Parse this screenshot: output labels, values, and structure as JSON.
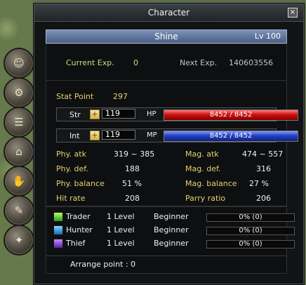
{
  "window": {
    "title": "Character",
    "close_icon": "×"
  },
  "character": {
    "name": "Shine",
    "level": "Lv 100"
  },
  "experience": {
    "current_label": "Current Exp.",
    "current_value": "0",
    "next_label": "Next Exp.",
    "next_value": "140603556"
  },
  "stat_point": {
    "label": "Stat Point",
    "value": "297"
  },
  "stats": {
    "str": {
      "label": "Str",
      "value": "119",
      "bar_label": "HP",
      "bar_text": "8452 / 8452",
      "fill_percent": 100
    },
    "int": {
      "label": "Int",
      "value": "119",
      "bar_label": "MP",
      "bar_text": "8452 / 8452",
      "fill_percent": 100
    }
  },
  "attributes": {
    "phy_atk_label": "Phy. atk",
    "phy_atk_value": "319 ~ 385",
    "phy_def_label": "Phy. def.",
    "phy_def_value": "188",
    "phy_balance_label": "Phy. balance",
    "phy_balance_value": "51 %",
    "hit_rate_label": "Hit rate",
    "hit_rate_value": "208",
    "mag_atk_label": "Mag. atk",
    "mag_atk_value": "474 ~ 557",
    "mag_def_label": "Mag. def.",
    "mag_def_value": "316",
    "mag_balance_label": "Mag. balance",
    "mag_balance_value": "27 %",
    "parry_ratio_label": "Parry ratio",
    "parry_ratio_value": "206"
  },
  "classes": [
    {
      "name": "Trader",
      "level": "1 Level",
      "rank": "Beginner",
      "progress_text": "0% (0)",
      "progress_percent": 0,
      "icon": "trader-icon"
    },
    {
      "name": "Hunter",
      "level": "1 Level",
      "rank": "Beginner",
      "progress_text": "0% (0)",
      "progress_percent": 0,
      "icon": "hunter-icon"
    },
    {
      "name": "Thief",
      "level": "1 Level",
      "rank": "Beginner",
      "progress_text": "0% (0)",
      "progress_percent": 0,
      "icon": "thief-icon"
    }
  ],
  "bottom": {
    "arrange_label": "Arrange point : 0"
  },
  "side_tabs": [
    {
      "name": "character-tab-icon"
    },
    {
      "name": "gear-tab-icon"
    },
    {
      "name": "book-tab-icon"
    },
    {
      "name": "boot-tab-icon"
    },
    {
      "name": "handshake-tab-icon"
    },
    {
      "name": "scroll-tab-icon"
    },
    {
      "name": "skill-tab-icon"
    }
  ]
}
